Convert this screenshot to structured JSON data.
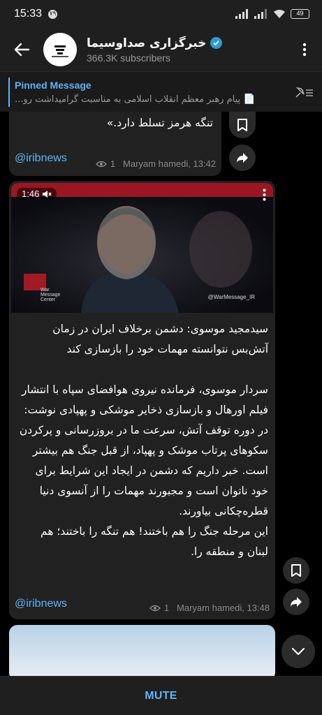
{
  "status_bar": {
    "time": "15:33",
    "notif_badge": "۷۹",
    "battery": "49"
  },
  "header": {
    "title": "خبرگزاری صداوسیما",
    "subscribers": "366.3K subscribers"
  },
  "pinned": {
    "title": "Pinned Message",
    "text": "پیام رهبر معظم انقلاب اسلامی به مناسبت گرامیداشت رو..."
  },
  "messages": [
    {
      "text": "تنگه هرمز تسلط دارد.»",
      "link": "@iribnews",
      "views": "1",
      "author_time": "Maryam hamedi, 13:42"
    },
    {
      "video_duration": "1:46",
      "video_watermark": "@WarMessage_IR",
      "video_label": "War Message Center",
      "paragraphs": [
        "سیدمجید موسوی: دشمن برخلاف ایران در زمان آتش‌بس نتوانسته مهمات خود را بازسازی کند",
        "سردار موسوی، فرمانده نیروی هوافضای سپاه با انتشار فیلم اورهال و بازسازی ذخایر موشکی و پهپادی نوشت:",
        "در دوره توقف آتش، سرعت ما در بروزرسانی و پرکردن سکوهای پرتاب موشک و پهپاد، از قبل جنگ هم بیشتر است. خبر داریم که دشمن در ایجاد این شرایط برای خود ناتوان است و مجبورند مهمات را از آنسوی دنیا قطره‌چکانی بیاورند.",
        "این مرحله جنگ را هم باختند! هم تنگه را باختند؛ هم لبنان و منطقه را."
      ],
      "link": "@iribnews",
      "views": "1",
      "author_time": "Maryam hamedi, 13:48"
    }
  ],
  "bottom": {
    "mute_label": "MUTE"
  },
  "colors": {
    "accent": "#5eb5f7",
    "bubble": "#212121",
    "bar": "#1f1f1f"
  }
}
